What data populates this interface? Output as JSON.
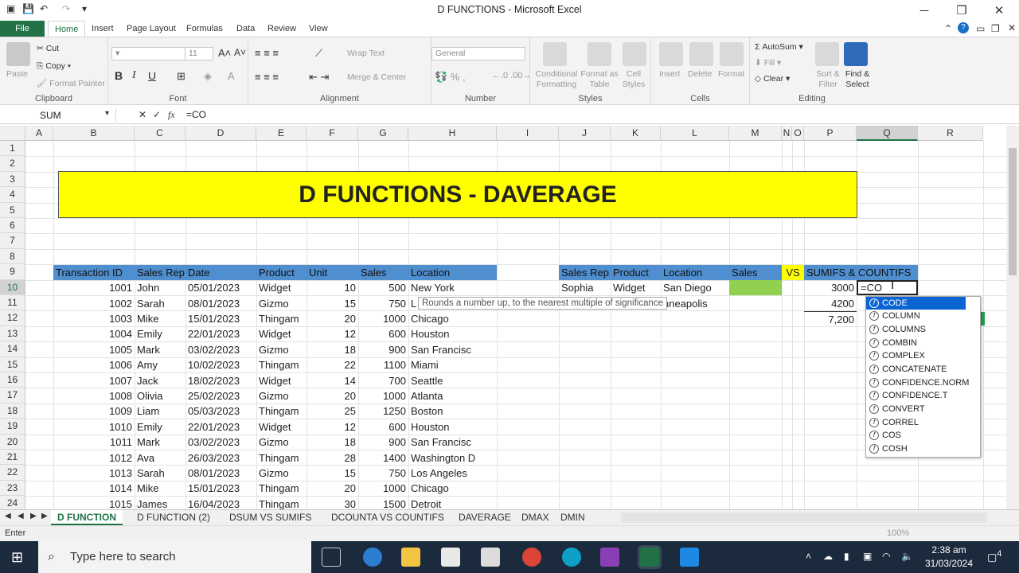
{
  "window": {
    "title": "D FUNCTIONS  -  Microsoft Excel"
  },
  "ribbon_tabs": [
    "File",
    "Home",
    "Insert",
    "Page Layout",
    "Formulas",
    "Data",
    "Review",
    "View"
  ],
  "ribbon": {
    "clipboard": {
      "label": "Clipboard",
      "paste": "Paste",
      "cut": "Cut",
      "copy": "Copy",
      "format_painter": "Format Painter"
    },
    "font": {
      "label": "Font",
      "size": "11",
      "bold": "B",
      "italic": "I",
      "underline": "U"
    },
    "alignment": {
      "label": "Alignment",
      "wrap_text": "Wrap Text",
      "merge_center": "Merge & Center"
    },
    "number": {
      "label": "Number",
      "format": "General"
    },
    "styles": {
      "label": "Styles",
      "conditional": "Conditional Formatting",
      "format_table": "Format as Table",
      "cell_styles": "Cell Styles"
    },
    "cells": {
      "label": "Cells",
      "insert": "Insert",
      "delete": "Delete",
      "format": "Format"
    },
    "editing": {
      "label": "Editing",
      "autosum": "AutoSum",
      "fill": "Fill",
      "clear": "Clear",
      "sort_filter": "Sort & Filter",
      "find_select": "Find & Select"
    }
  },
  "formula_bar": {
    "name_box": "SUM",
    "formula": "=CO"
  },
  "columns": [
    "A",
    "B",
    "C",
    "D",
    "E",
    "F",
    "G",
    "H",
    "I",
    "J",
    "K",
    "L",
    "M",
    "N",
    "O",
    "P",
    "Q",
    "R"
  ],
  "rows": [
    "1",
    "2",
    "3",
    "4",
    "5",
    "6",
    "7",
    "8",
    "9",
    "10",
    "11",
    "12",
    "13",
    "14",
    "15",
    "16",
    "17",
    "18",
    "19",
    "20",
    "21",
    "22",
    "23",
    "24"
  ],
  "banner": "D FUNCTIONS - DAVERAGE",
  "table_headers": [
    "Transaction ID",
    "Sales Rep",
    "Date",
    "Product",
    "Unit",
    "Sales",
    "Location"
  ],
  "table_rows": [
    [
      "1001",
      "John",
      "05/01/2023",
      "Widget",
      "10",
      "500",
      "New York"
    ],
    [
      "1002",
      "Sarah",
      "08/01/2023",
      "Gizmo",
      "15",
      "750",
      "L"
    ],
    [
      "1003",
      "Mike",
      "15/01/2023",
      "Thingam",
      "20",
      "1000",
      "Chicago"
    ],
    [
      "1004",
      "Emily",
      "22/01/2023",
      "Widget",
      "12",
      "600",
      "Houston"
    ],
    [
      "1005",
      "Mark",
      "03/02/2023",
      "Gizmo",
      "18",
      "900",
      "San Francisc"
    ],
    [
      "1006",
      "Amy",
      "10/02/2023",
      "Thingam",
      "22",
      "1100",
      "Miami"
    ],
    [
      "1007",
      "Jack",
      "18/02/2023",
      "Widget",
      "14",
      "700",
      "Seattle"
    ],
    [
      "1008",
      "Olivia",
      "25/02/2023",
      "Gizmo",
      "20",
      "1000",
      "Atlanta"
    ],
    [
      "1009",
      "Liam",
      "05/03/2023",
      "Thingam",
      "25",
      "1250",
      "Boston"
    ],
    [
      "1010",
      "Emily",
      "22/01/2023",
      "Widget",
      "12",
      "600",
      "Houston"
    ],
    [
      "1011",
      "Mark",
      "03/02/2023",
      "Gizmo",
      "18",
      "900",
      "San Francisc"
    ],
    [
      "1012",
      "Ava",
      "26/03/2023",
      "Thingam",
      "28",
      "1400",
      "Washington D"
    ],
    [
      "1013",
      "Sarah",
      "08/01/2023",
      "Gizmo",
      "15",
      "750",
      "Los Angeles"
    ],
    [
      "1014",
      "Mike",
      "15/01/2023",
      "Thingam",
      "20",
      "1000",
      "Chicago"
    ],
    [
      "1015",
      "James",
      "16/04/2023",
      "Thingam",
      "30",
      "1500",
      "Detroit"
    ]
  ],
  "criteria": {
    "headers": [
      "Sales Rep",
      "Product",
      "Location",
      "Sales"
    ],
    "vs": "VS",
    "sumifs_header": "SUMIFS & COUNTIFS",
    "row10": [
      "Sophia",
      "Widget",
      "San Diego"
    ],
    "row11_location": "nneapolis",
    "p10": "3000",
    "p11": "4200",
    "p12": "7,200",
    "q10_edit": "=CO"
  },
  "tooltip": "Rounds a number up, to the nearest multiple of significance",
  "autocomplete": [
    "CODE",
    "COLUMN",
    "COLUMNS",
    "COMBIN",
    "COMPLEX",
    "CONCATENATE",
    "CONFIDENCE.NORM",
    "CONFIDENCE.T",
    "CONVERT",
    "CORREL",
    "COS",
    "COSH"
  ],
  "sheet_tabs": [
    "D FUNCTION",
    "D FUNCTION (2)",
    "DSUM VS SUMIFS",
    "DCOUNTA VS COUNTIFS",
    "DAVERAGE",
    "DMAX",
    "DMIN"
  ],
  "status": {
    "mode": "Enter",
    "zoom": "100%"
  },
  "taskbar": {
    "search_placeholder": "Type here to search",
    "time": "2:38 am",
    "date": "31/03/2024",
    "notifications": "4"
  },
  "colors": {
    "excel_green": "#217346",
    "header_blue": "#4f8ecf",
    "banner_yellow": "#ffff00",
    "vs_yellow": "#ffff00",
    "cell_green": "#92d050",
    "select_blue": "#0a64d2"
  }
}
